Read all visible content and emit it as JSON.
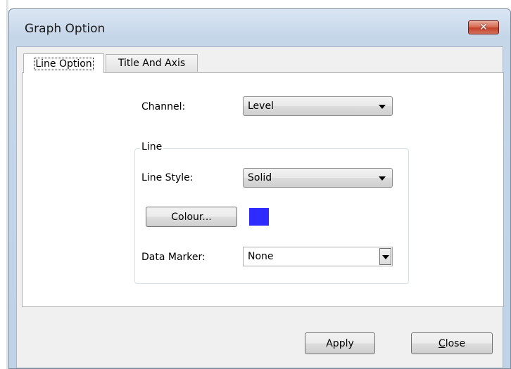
{
  "window": {
    "title": "Graph Option",
    "close_glyph": "✕"
  },
  "tabs": [
    {
      "label": "Line Option",
      "active": true
    },
    {
      "label": "Title And Axis",
      "active": false
    }
  ],
  "line_option": {
    "channel_label": "Channel:",
    "channel_value": "Level",
    "group_title": "Line",
    "line_style_label": "Line Style:",
    "line_style_value": "Solid",
    "colour_button": "Colour...",
    "colour_swatch": "#2d2bff",
    "data_marker_label": "Data Marker:",
    "data_marker_value": "None"
  },
  "footer": {
    "apply_label": "Apply",
    "close_first": "C",
    "close_rest": "lose"
  },
  "icons": {
    "close": "close-icon",
    "dropdown": "chevron-down-icon"
  }
}
